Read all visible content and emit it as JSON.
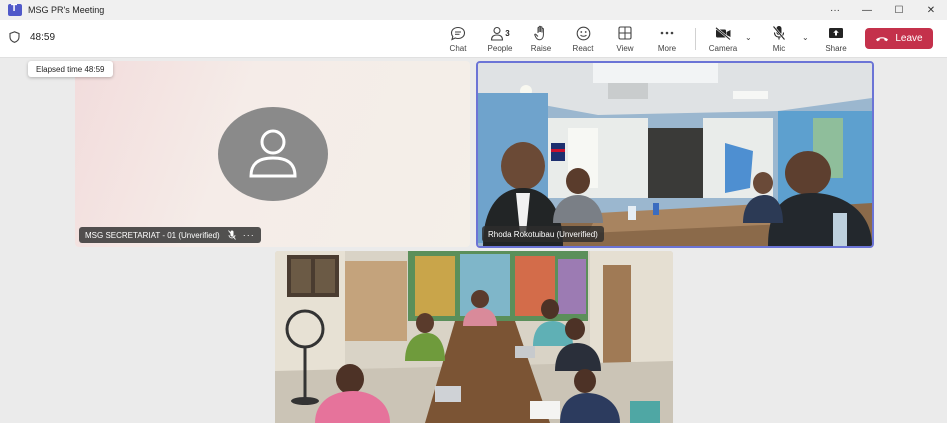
{
  "window": {
    "title": "MSG PR's Meeting",
    "controls": [
      "···",
      "—",
      "☐",
      "✕"
    ]
  },
  "toolbar": {
    "timer": "48:59",
    "chat": "Chat",
    "people": "People",
    "people_count": "3",
    "raise": "Raise",
    "react": "React",
    "view": "View",
    "more": "More",
    "camera": "Camera",
    "mic": "Mic",
    "share": "Share",
    "leave": "Leave"
  },
  "tooltip": {
    "text": "Elapsed time 48:59"
  },
  "participants": [
    {
      "name": "MSG SECRETARIAT - 01 (Unverified)"
    },
    {
      "name": "Rhoda Rokotuibau (Unverified)"
    }
  ],
  "colors": {
    "leave": "#c4314b",
    "active_speaker_border": "#6b74d6",
    "avatar": "#8a8a8a"
  }
}
